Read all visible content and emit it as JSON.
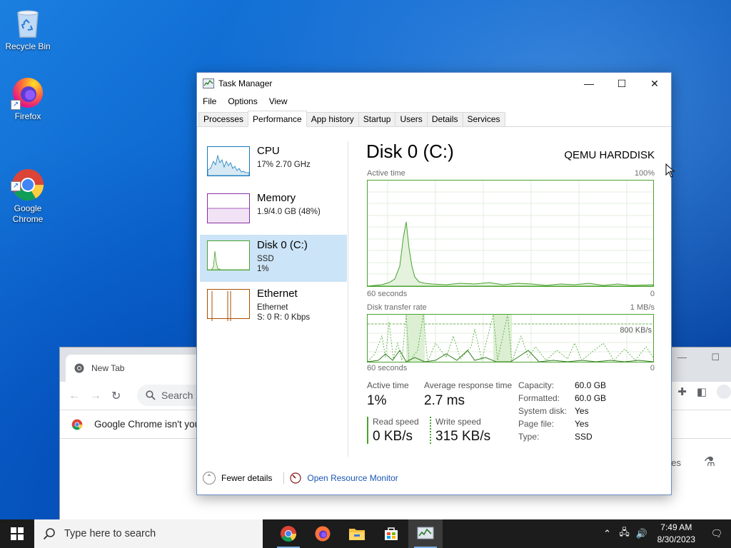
{
  "desktop": {
    "icons": [
      {
        "label": "Recycle Bin"
      },
      {
        "label": "Firefox"
      },
      {
        "label": "Google\nChrome"
      }
    ]
  },
  "chrome": {
    "tab_title": "New Tab",
    "search_placeholder": "Search G",
    "infobar_text": "Google Chrome isn't you",
    "partial_text": "es"
  },
  "task_manager": {
    "title": "Task Manager",
    "menu": [
      "File",
      "Options",
      "View"
    ],
    "tabs": [
      "Processes",
      "Performance",
      "App history",
      "Startup",
      "Users",
      "Details",
      "Services"
    ],
    "active_tab": "Performance",
    "sidebar": [
      {
        "name": "CPU",
        "line1": "17%  2.70 GHz",
        "line2": ""
      },
      {
        "name": "Memory",
        "line1": "1.9/4.0 GB (48%)",
        "line2": ""
      },
      {
        "name": "Disk 0 (C:)",
        "line1": "SSD",
        "line2": "1%"
      },
      {
        "name": "Ethernet",
        "line1": "Ethernet",
        "line2": "S: 0  R: 0 Kbps"
      }
    ],
    "detail": {
      "title": "Disk 0 (C:)",
      "model": "QEMU HARDDISK",
      "graph1": {
        "label": "Active time",
        "max": "100%",
        "time": "60 seconds",
        "min": "0"
      },
      "graph2": {
        "label": "Disk transfer rate",
        "max": "1 MB/s",
        "mid": "800 KB/s",
        "time": "60 seconds",
        "min": "0"
      },
      "stats": {
        "active_time_label": "Active time",
        "active_time_value": "1%",
        "avg_response_label": "Average response time",
        "avg_response_value": "2.7 ms",
        "read_speed_label": "Read speed",
        "read_speed_value": "0 KB/s",
        "write_speed_label": "Write speed",
        "write_speed_value": "315 KB/s"
      },
      "properties": [
        {
          "key": "Capacity:",
          "value": "60.0 GB"
        },
        {
          "key": "Formatted:",
          "value": "60.0 GB"
        },
        {
          "key": "System disk:",
          "value": "Yes"
        },
        {
          "key": "Page file:",
          "value": "Yes"
        },
        {
          "key": "Type:",
          "value": "SSD"
        }
      ]
    },
    "footer": {
      "fewer_details": "Fewer details",
      "open_resource_monitor": "Open Resource Monitor"
    }
  },
  "taskbar": {
    "search_placeholder": "Type here to search",
    "apps": [
      "chrome-icon",
      "firefox-icon",
      "file-explorer-icon",
      "store-icon",
      "task-manager-icon"
    ],
    "time": "7:49 AM",
    "date": "8/30/2023"
  },
  "colors": {
    "disk_graph": "#4aa22e",
    "cpu_graph": "#1779ba",
    "memory_graph": "#8b2fa6",
    "ethernet_graph": "#a74f01",
    "selection": "#cce4f7",
    "link": "#1a56b3"
  }
}
